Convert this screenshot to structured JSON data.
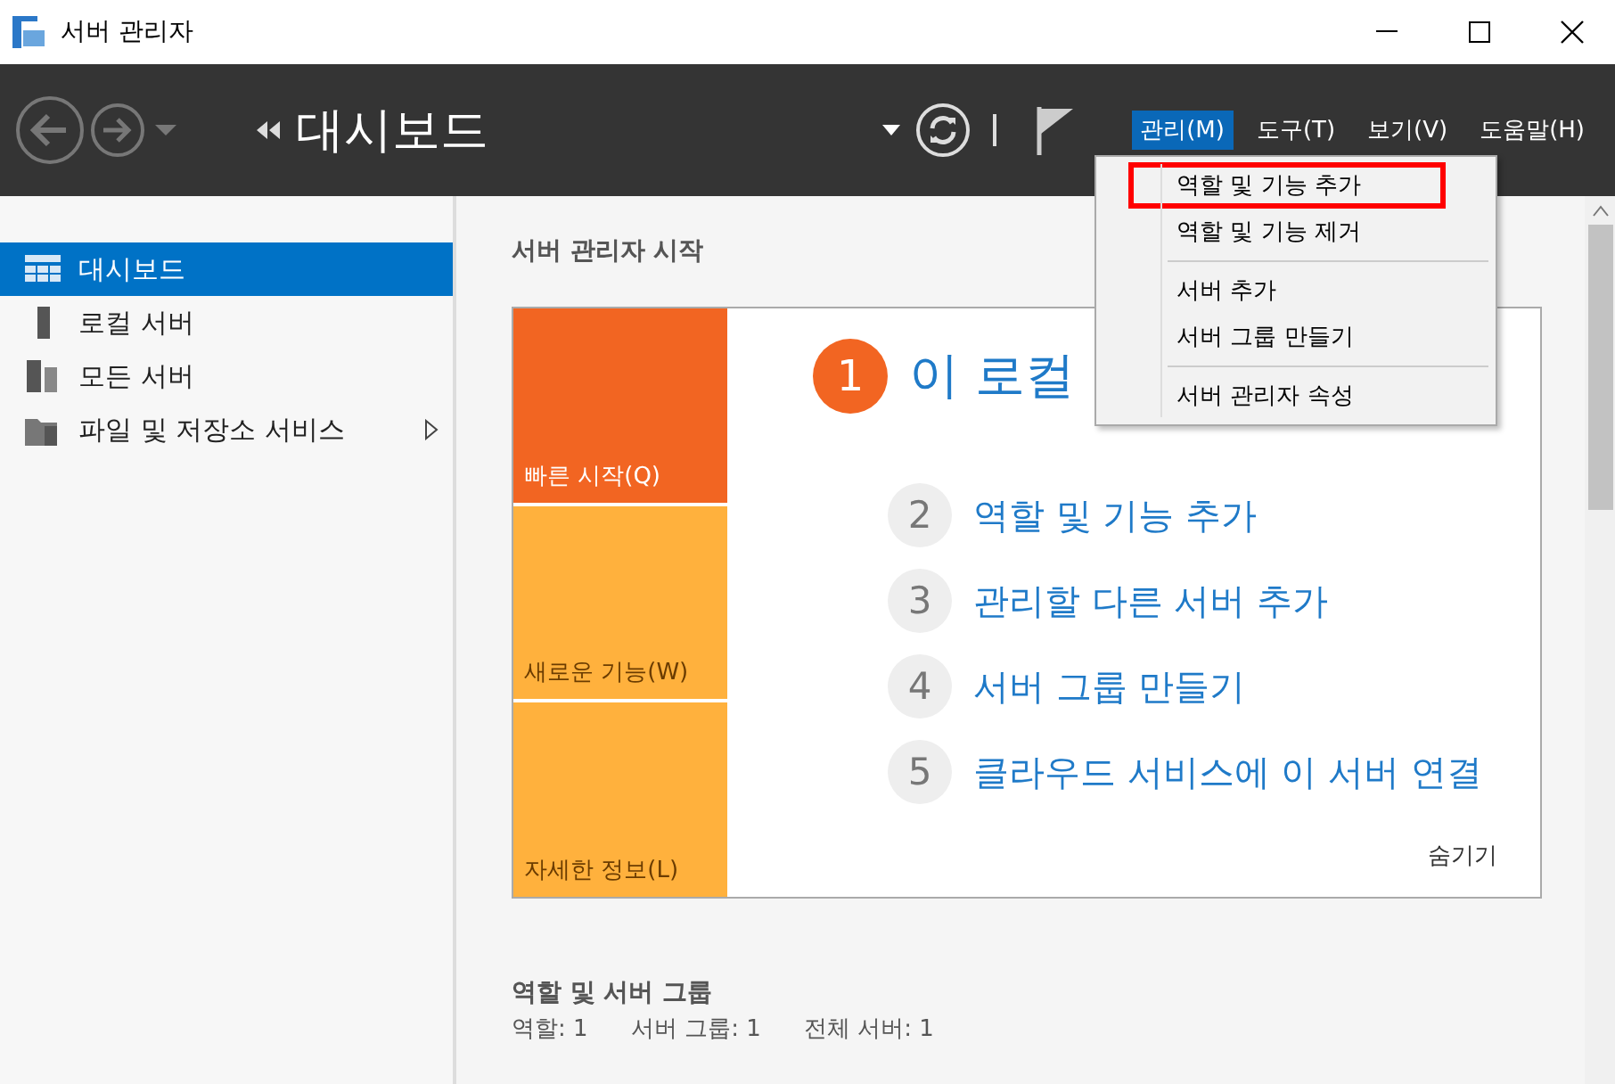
{
  "window": {
    "title": "서버 관리자"
  },
  "toolbar": {
    "title": "대시보드",
    "menus": [
      {
        "label": "관리(M)",
        "selected": true
      },
      {
        "label": "도구(T)",
        "selected": false
      },
      {
        "label": "보기(V)",
        "selected": false
      },
      {
        "label": "도움말(H)",
        "selected": false
      }
    ]
  },
  "dropdown_menu": {
    "sections": [
      [
        {
          "label": "역할 및 기능 추가",
          "highlighted": true
        },
        {
          "label": "역할 및 기능 제거",
          "highlighted": false
        }
      ],
      [
        {
          "label": "서버 추가",
          "highlighted": false
        },
        {
          "label": "서버 그룹 만들기",
          "highlighted": false
        }
      ],
      [
        {
          "label": "서버 관리자 속성",
          "highlighted": false
        }
      ]
    ]
  },
  "sidebar": {
    "items": [
      {
        "label": "대시보드",
        "kind": "dashboard",
        "selected": true,
        "has_submenu": false
      },
      {
        "label": "로컬 서버",
        "kind": "server",
        "selected": false,
        "has_submenu": false
      },
      {
        "label": "모든 서버",
        "kind": "servers",
        "selected": false,
        "has_submenu": false
      },
      {
        "label": "파일 및 저장소 서비스",
        "kind": "files",
        "selected": false,
        "has_submenu": true
      }
    ]
  },
  "main": {
    "heading": "서버 관리자 시작",
    "tiles": [
      {
        "label": "빠른 시작(Q)",
        "selected": true
      },
      {
        "label": "새로운 기능(W)",
        "selected": false
      },
      {
        "label": "자세한 정보(L)",
        "selected": false
      }
    ],
    "steps": [
      {
        "number": "1",
        "label": "이 로컬",
        "primary": true
      },
      {
        "number": "2",
        "label": "역할 및 기능 추가",
        "primary": false
      },
      {
        "number": "3",
        "label": "관리할 다른 서버 추가",
        "primary": false
      },
      {
        "number": "4",
        "label": "서버 그룹 만들기",
        "primary": false
      },
      {
        "number": "5",
        "label": "클라우드 서비스에 이 서버 연결",
        "primary": false
      }
    ],
    "hide_link": "숨기기",
    "section_title": "역할 및 서버 그룹",
    "stats": [
      "역할: 1",
      "서버 그룹: 1",
      "전체 서버: 1"
    ]
  }
}
